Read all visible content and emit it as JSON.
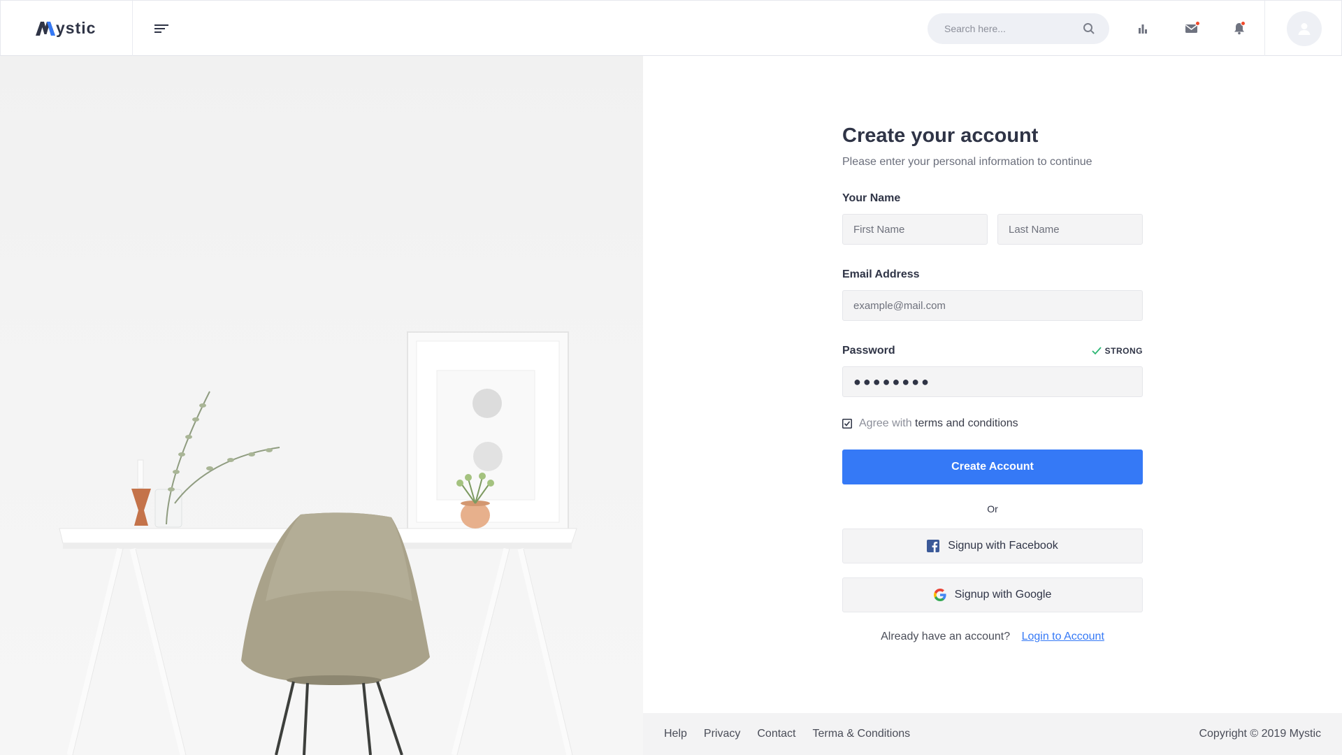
{
  "brand": {
    "name": "ystic"
  },
  "header": {
    "search_placeholder": "Search here...",
    "icons": [
      "menu-icon",
      "search-icon",
      "bar-chart-icon",
      "mail-icon",
      "bell-icon",
      "user-icon"
    ],
    "notification_dot_color": "#f04a2c"
  },
  "form": {
    "title": "Create your account",
    "subtitle": "Please enter your personal information to continue",
    "name_label": "Your Name",
    "first_name_placeholder": "First Name",
    "last_name_placeholder": "Last Name",
    "email_label": "Email Address",
    "email_placeholder": "example@mail.com",
    "password_label": "Password",
    "password_strength": "STRONG",
    "password_value": "●●●●●●●●",
    "agree_prefix": "Agree with",
    "agree_link": "terms and conditions",
    "agree_checked": true,
    "create_button": "Create Account",
    "or_text": "Or",
    "facebook_button": "Signup with Facebook",
    "google_button": "Signup with Google",
    "login_prompt": "Already have an account?",
    "login_link": "Login to Account"
  },
  "footer": {
    "links": [
      "Help",
      "Privacy",
      "Contact",
      "Terma & Conditions"
    ],
    "copyright": "Copyright © 2019 Mystic"
  },
  "colors": {
    "accent": "#3579f6",
    "strong": "#2bb673"
  }
}
